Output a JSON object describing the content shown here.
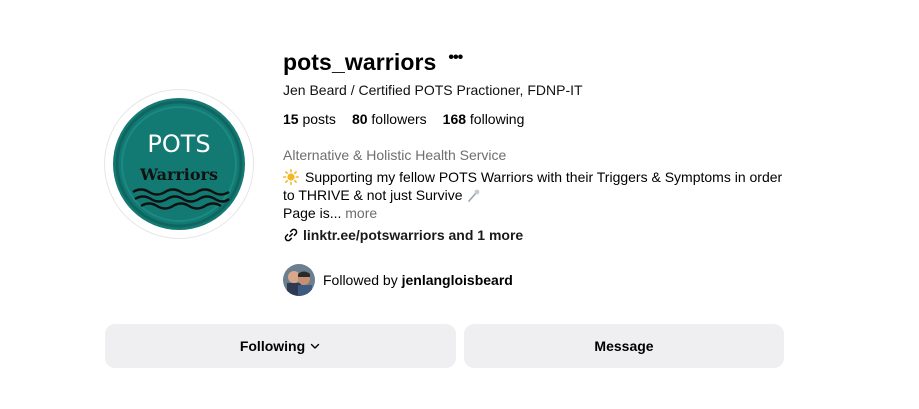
{
  "profile": {
    "username": "pots_warriors",
    "more_icon": "more-horizontal-icon",
    "full_name": "Jen Beard / Certified POTS Practioner, FDNP-IT",
    "avatar_text_line1": "POTS",
    "avatar_text_line2": "Warriors",
    "avatar_color": "#137a73"
  },
  "stats": {
    "posts_count": "15",
    "posts_label": "posts",
    "followers_count": "80",
    "followers_label": "followers",
    "following_count": "168",
    "following_label": "following"
  },
  "bio": {
    "category": "Alternative & Holistic Health Service",
    "sun_icon": "sun-emoji-icon",
    "line1": "Supporting my fellow POTS Warriors with their Triggers & Symptoms in order",
    "line2": "to THRIVE & not just Survive",
    "pin_icon": "pin-emoji-icon",
    "line3": "Page is...",
    "more_label": "more"
  },
  "link": {
    "icon": "link-icon",
    "text": "linktr.ee/potswarriors and 1 more"
  },
  "followed_by": {
    "prefix": "Followed by",
    "user": "jenlangloisbeard"
  },
  "actions": {
    "following_label": "Following",
    "message_label": "Message",
    "button_bg": "#efeff2"
  }
}
